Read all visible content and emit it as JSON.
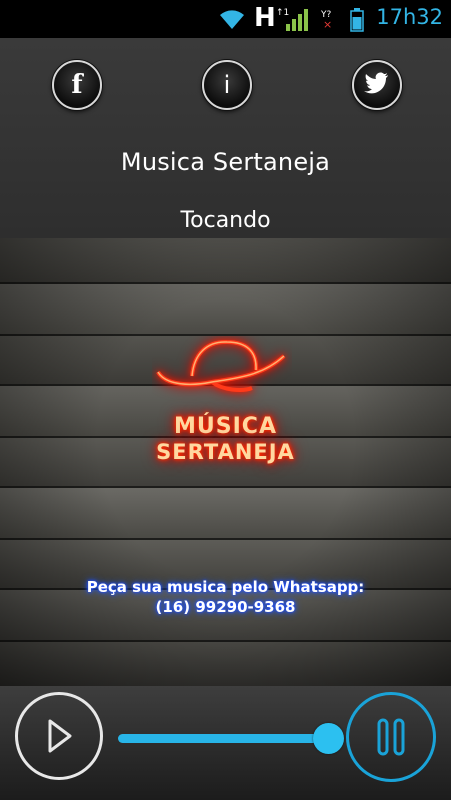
{
  "status_bar": {
    "time": "17h32",
    "network_type": "H",
    "icons": [
      "wifi-icon",
      "signal-icon",
      "no-signal-icon",
      "battery-icon"
    ],
    "accent_color": "#33b5e5"
  },
  "header": {
    "social": [
      {
        "label": "f",
        "icon": "facebook-icon"
      },
      {
        "label": "i",
        "icon": "info-icon"
      },
      {
        "label": "",
        "icon": "twitter-icon"
      }
    ],
    "station_title": "Musica Sertaneja",
    "status": "Tocando"
  },
  "artwork": {
    "logo_line1": "MÚSICA",
    "logo_line2": "SERTANEJA",
    "promo_line1": "Peça sua musica pelo Whatsapp:",
    "promo_line2": "(16) 99290-9368"
  },
  "player": {
    "play_icon": "play-icon",
    "pause_icon": "pause-icon",
    "volume_level": 1.0,
    "accent_color": "#28b5e8"
  }
}
